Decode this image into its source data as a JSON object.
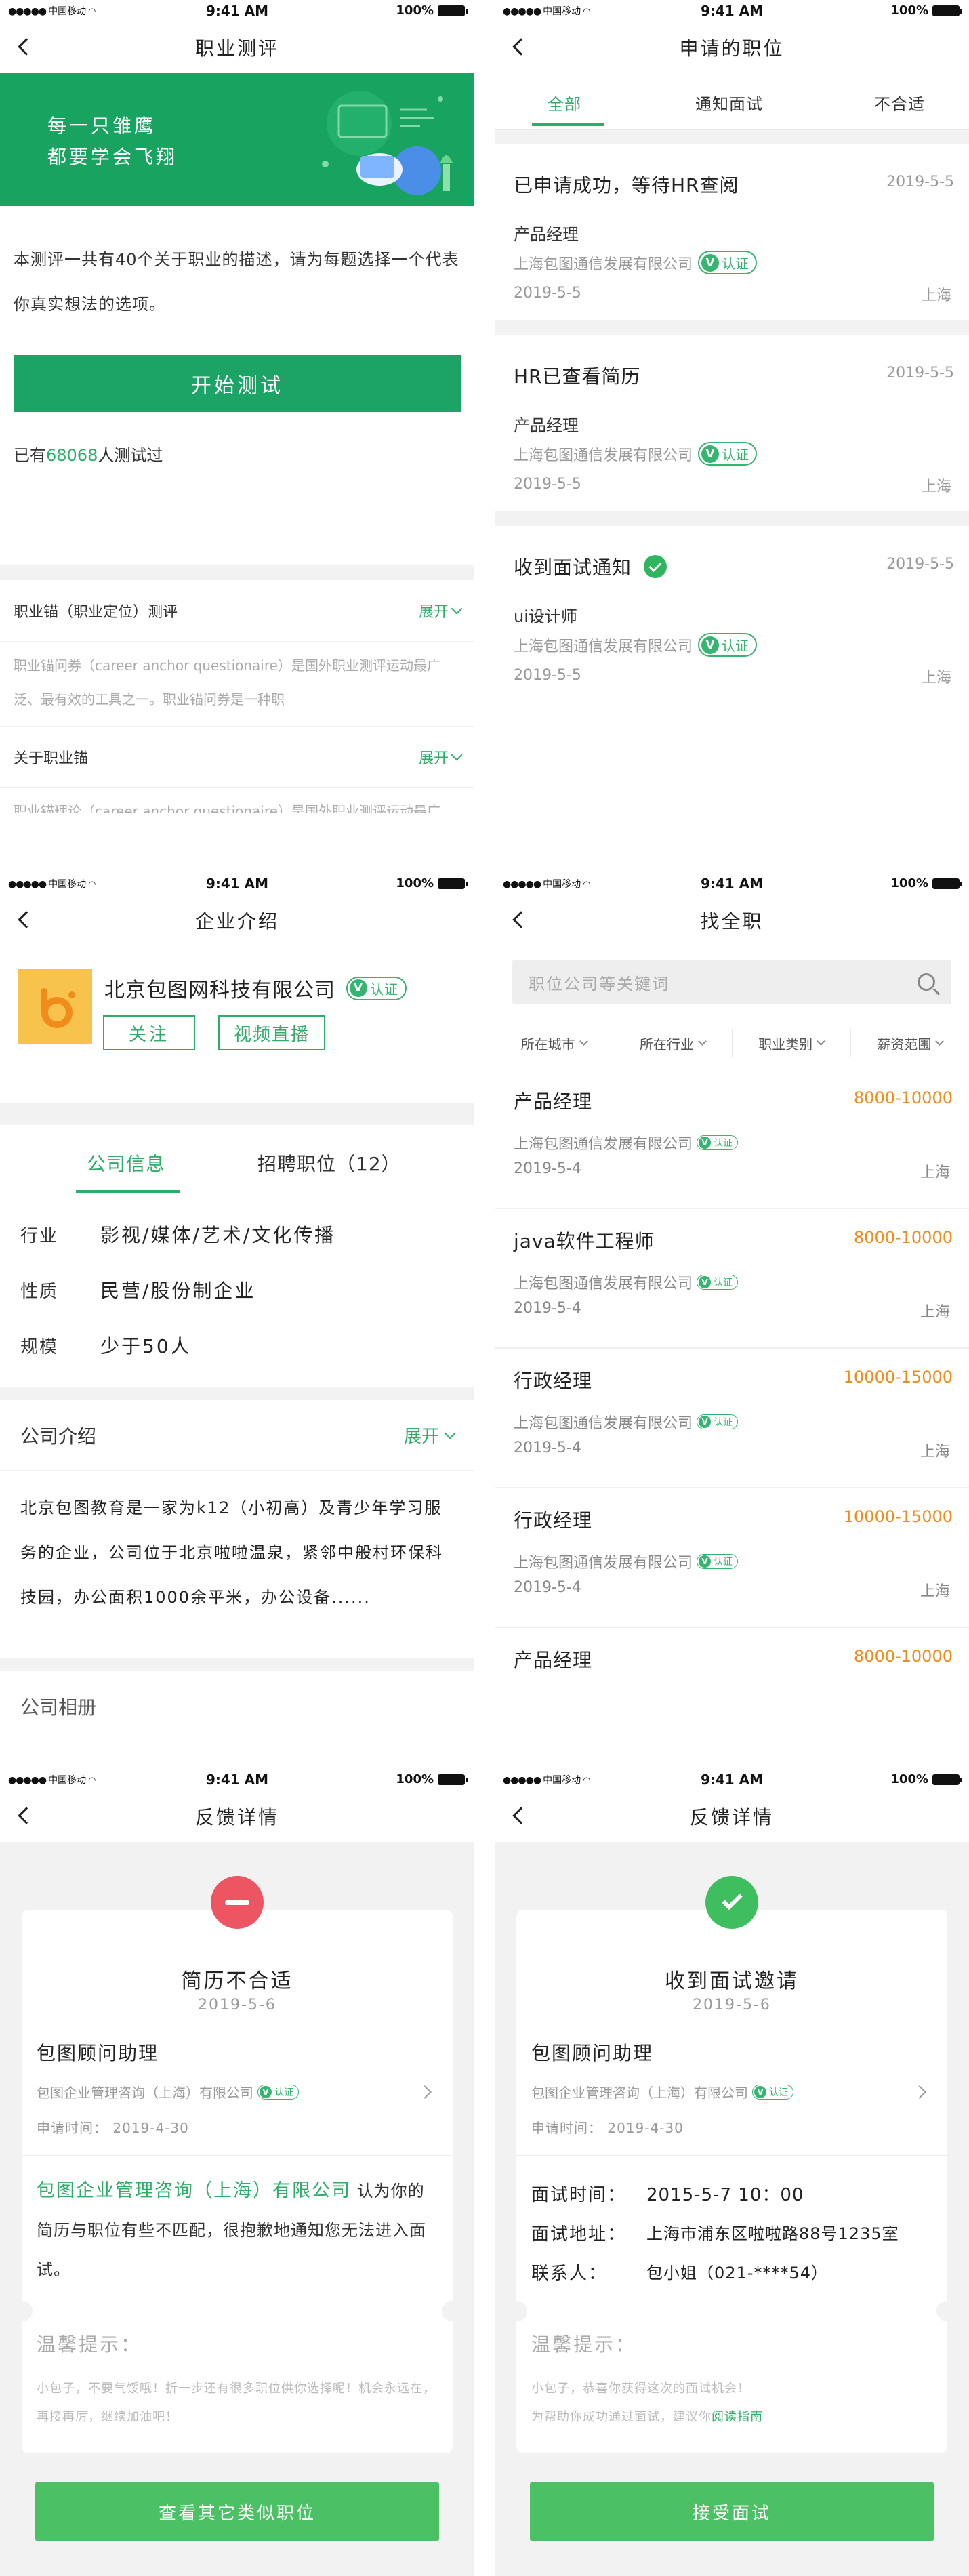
{
  "status_bar": {
    "carrier": "中国移动",
    "time": "9:41 AM",
    "battery": "100%"
  },
  "screen1": {
    "title": "职业测评",
    "banner_line1": "每一只雏鹰",
    "banner_line2": "都要学会飞翔",
    "intro": "本测评一共有40个关于职业的描述，请为每题选择一个代表你真实想法的选项。",
    "start_button": "开始测试",
    "tested_prefix": "已有",
    "tested_count": "68068",
    "tested_suffix": "人测试过",
    "sections": [
      {
        "title": "职业锚（职业定位）测评",
        "expand": "展开",
        "body": "职业锚问券（career anchor questionaire）是国外职业测评运动最广泛、最有效的工具之一。职业锚问券是一种职"
      },
      {
        "title": "关于职业锚",
        "expand": "展开",
        "body": "职业锚理论（career anchor questionaire）是国外职业测评运动最广泛、最有效的工具之一。职业锚问券是一种职"
      }
    ]
  },
  "screen2": {
    "title": "申请的职位",
    "tabs": [
      "全部",
      "通知面试",
      "不合适"
    ],
    "cards": [
      {
        "status": "已申请成功，等待HR查阅",
        "date": "2019-5-5",
        "job": "产品经理",
        "company": "上海包图通信发展有限公司",
        "badge": "认证",
        "applied": "2019-5-5",
        "city": "上海"
      },
      {
        "status": "HR已查看简历",
        "date": "2019-5-5",
        "job": "产品经理",
        "company": "上海包图通信发展有限公司",
        "badge": "认证",
        "applied": "2019-5-5",
        "city": "上海"
      },
      {
        "status": "收到面试通知",
        "date": "2019-5-5",
        "job": "ui设计师",
        "company": "上海包图通信发展有限公司",
        "badge": "认证",
        "applied": "2019-5-5",
        "city": "上海"
      }
    ]
  },
  "screen3": {
    "title": "企业介绍",
    "company_name": "北京包图网科技有限公司",
    "badge": "认证",
    "follow_button": "关注",
    "live_button": "视频直播",
    "tabs": [
      "公司信息",
      "招聘职位（12）"
    ],
    "info": [
      {
        "key": "行业",
        "value": "影视/媒体/艺术/文化传播"
      },
      {
        "key": "性质",
        "value": "民营/股份制企业"
      },
      {
        "key": "规模",
        "value": "少于50人"
      }
    ],
    "intro_title": "公司介绍",
    "expand": "展开",
    "intro_text": "北京包图教育是一家为k12（小初高）及青少年学习服务的企业，公司位于北京啦啦温泉，紧邻中般村环保科技园，办公面积1000余平米，办公设备......",
    "album_title": "公司相册"
  },
  "screen4": {
    "title": "找全职",
    "search_placeholder": "职位公司等关键词",
    "filters": [
      "所在城市",
      "所在行业",
      "职业类别",
      "薪资范围"
    ],
    "jobs": [
      {
        "title": "产品经理",
        "salary": "8000-10000",
        "company": "上海包图通信发展有限公司",
        "badge": "认证",
        "date": "2019-5-4",
        "city": "上海"
      },
      {
        "title": "java软件工程师",
        "salary": "8000-10000",
        "company": "上海包图通信发展有限公司",
        "badge": "认证",
        "date": "2019-5-4",
        "city": "上海"
      },
      {
        "title": "行政经理",
        "salary": "10000-15000",
        "company": "上海包图通信发展有限公司",
        "badge": "认证",
        "date": "2019-5-4",
        "city": "上海"
      },
      {
        "title": "行政经理",
        "salary": "10000-15000",
        "company": "上海包图通信发展有限公司",
        "badge": "认证",
        "date": "2019-5-4",
        "city": "上海"
      },
      {
        "title": "产品经理",
        "salary": "8000-10000",
        "company": "",
        "badge": "",
        "date": "",
        "city": ""
      }
    ]
  },
  "screen5": {
    "title": "反馈详情",
    "result": "简历不合适",
    "date": "2019-5-6",
    "job": "包图顾问助理",
    "company": "包图企业管理咨询（上海）有限公司",
    "badge": "认证",
    "apply_time": "申请时间：  2019-4-30",
    "msg_company": "包图企业管理咨询（上海）有限公司",
    "msg_text": "认为你的简历与职位有些不匹配，很抱歉地通知您无法进入面试。",
    "tip_title": "温馨提示：",
    "tip_text": "小包子，不要气馁哦！折一步还有很多职位供你选择呢！机会永远在，再接再厉，继续加油吧！",
    "button": "查看其它类似职位"
  },
  "screen6": {
    "title": "反馈详情",
    "result": "收到面试邀请",
    "date": "2019-5-6",
    "job": "包图顾问助理",
    "company": "包图企业管理咨询（上海）有限公司",
    "badge": "认证",
    "apply_time": "申请时间：  2019-4-30",
    "interview_time_label": "面试时间：",
    "interview_time": "2015-5-7 10：00",
    "interview_addr_label": "面试地址：",
    "interview_addr": "上海市浦东区啦啦路88号1235室",
    "contact_label": "联系人：",
    "contact": "包小姐（021-****54）",
    "tip_title": "温馨提示：",
    "tip_text_1": "小包子，恭喜你获得这次的面试机会！",
    "tip_text_2": "为帮助你成功通过面试，建议你",
    "tip_link": "阅读指南",
    "button": "接受面试"
  }
}
